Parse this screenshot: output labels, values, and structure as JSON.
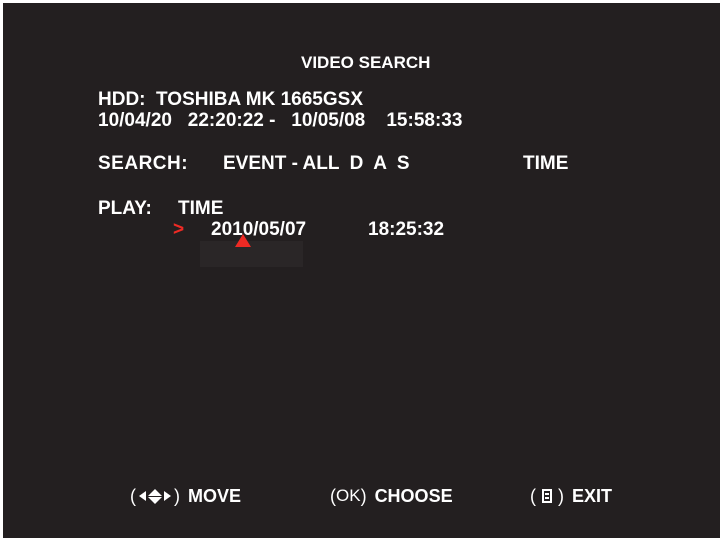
{
  "screen": {
    "title": "VIDEO SEARCH",
    "hdd_line": "HDD:  TOSHIBA MK 1665GSX",
    "range_line": "10/04/20   22:20:22 -   10/05/08    15:58:33",
    "search": {
      "label": "SEARCH:",
      "mode": "EVENT - ALL  D  A  S",
      "type": "TIME"
    },
    "play": {
      "label": "PLAY:",
      "mode": "TIME",
      "cursor": ">",
      "date": "2010/05/07",
      "time": "18:25:32"
    }
  },
  "footer": {
    "move": {
      "open": "(",
      "close": ")",
      "label": "MOVE"
    },
    "choose": {
      "open": "(",
      "key": "OK",
      "close": ")",
      "label": "CHOOSE"
    },
    "exit": {
      "open": "(",
      "close": ")",
      "label": "EXIT"
    }
  },
  "colors": {
    "background": "#231f20",
    "text": "#ffffff",
    "accent": "#ee2a24"
  }
}
